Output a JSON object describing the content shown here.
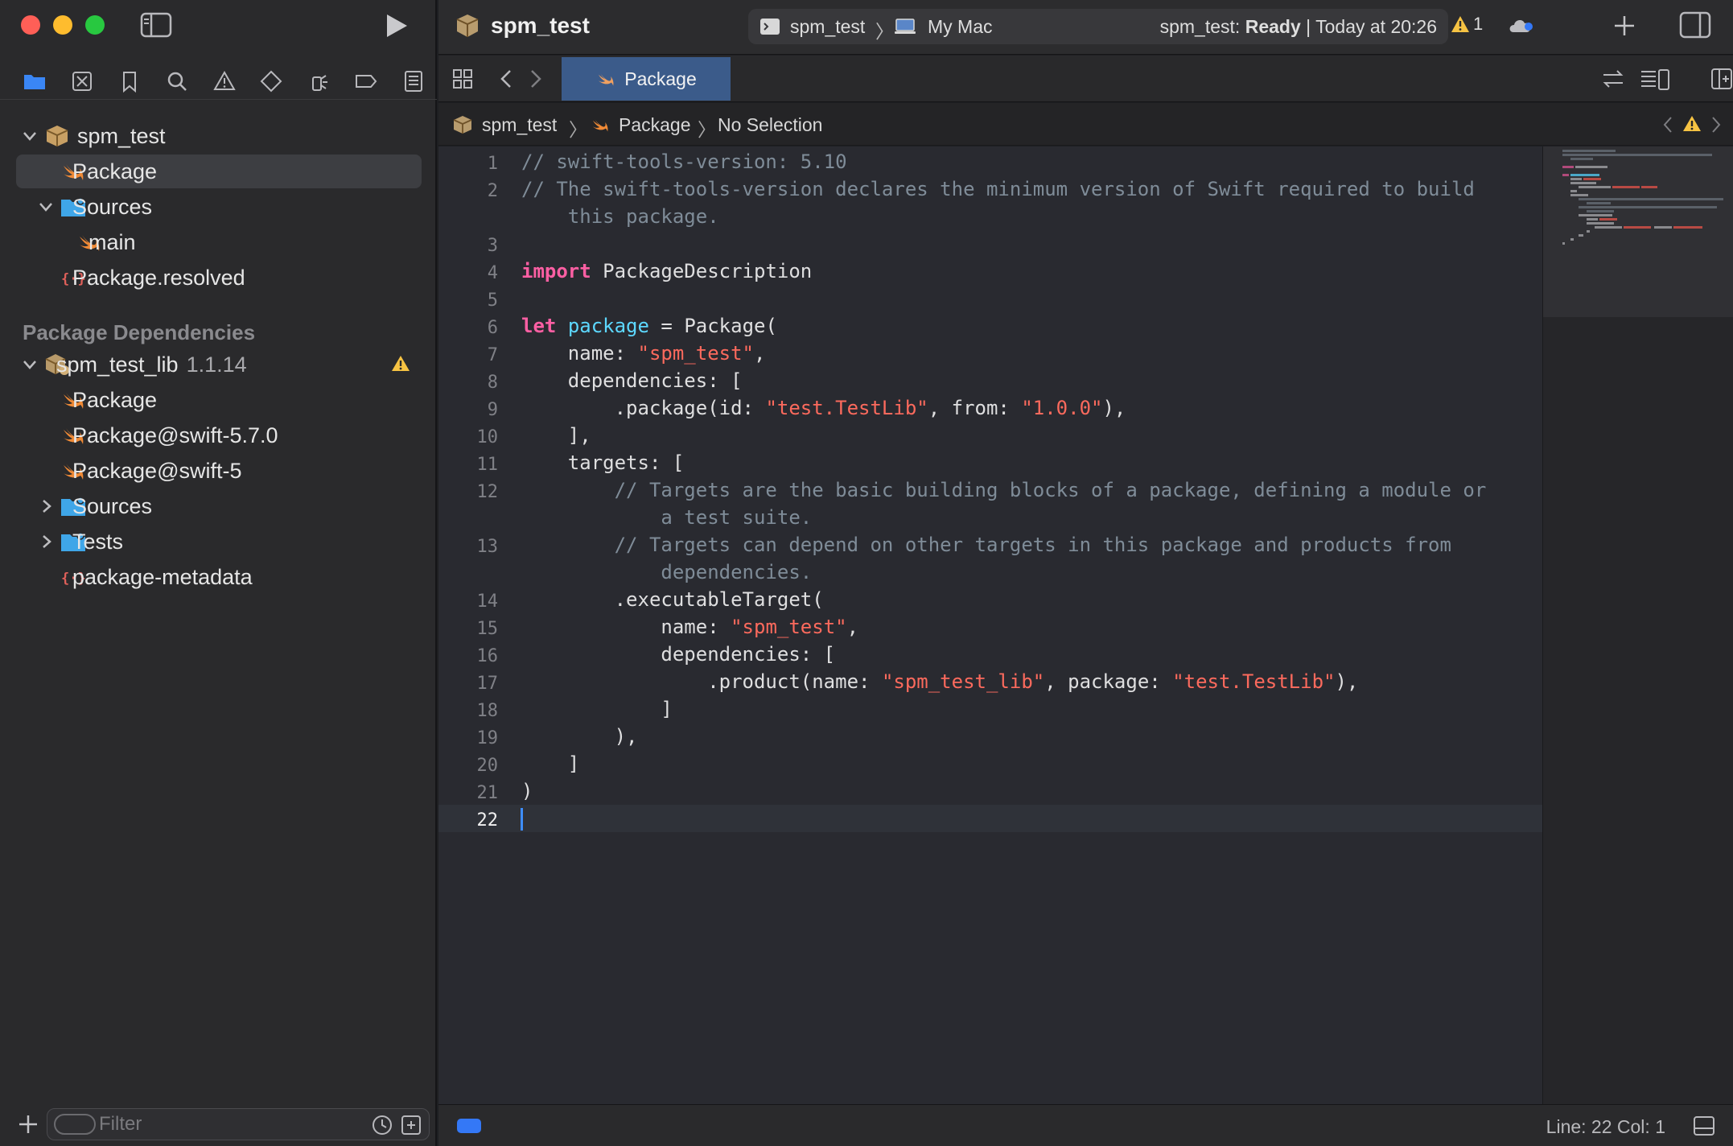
{
  "window": {
    "project_title": "spm_test",
    "scheme": "spm_test",
    "destination": "My Mac",
    "status_prefix": "spm_test:",
    "status_state": "Ready",
    "status_time": "| Today at 20:26",
    "warning_count": "1"
  },
  "tab": {
    "label": "Package"
  },
  "jumpbar": {
    "project": "spm_test",
    "file": "Package",
    "selection": "No Selection"
  },
  "navigator": {
    "project": {
      "name": "spm_test",
      "items": [
        {
          "label": "Package"
        },
        {
          "label": "Sources"
        },
        {
          "label": "main"
        },
        {
          "label": "Package.resolved"
        }
      ]
    },
    "dependencies_title": "Package Dependencies",
    "dependency": {
      "name": "spm_test_lib",
      "version": "1.1.14",
      "items": [
        {
          "label": "Package"
        },
        {
          "label": "Package@swift-5.7.0"
        },
        {
          "label": "Package@swift-5"
        },
        {
          "label": "Sources"
        },
        {
          "label": "Tests"
        },
        {
          "label": "package-metadata"
        }
      ]
    },
    "filter_placeholder": "Filter"
  },
  "editor": {
    "line_numbers": [
      "1",
      "2",
      "3",
      "4",
      "5",
      "6",
      "7",
      "8",
      "9",
      "10",
      "11",
      "12",
      "13",
      "14",
      "15",
      "16",
      "17",
      "18",
      "19",
      "20",
      "21",
      "22"
    ],
    "code": {
      "l1": "// swift-tools-version: 5.10",
      "l2a": "// The swift-tools-version declares the minimum version of Swift required to build",
      "l2b": "    this package.",
      "l4_kw": "import",
      "l4_rest": " PackageDescription",
      "l6_kw": "let",
      "l6_name": "package",
      "l6_rest": " = Package(",
      "l7_pre": "    name: ",
      "l7_str": "\"spm_test\"",
      "l7_post": ",",
      "l8": "    dependencies: [",
      "l9_pre": "        .package(id: ",
      "l9_str1": "\"test.TestLib\"",
      "l9_mid": ", from: ",
      "l9_str2": "\"1.0.0\"",
      "l9_post": "),",
      "l10": "    ],",
      "l11": "    targets: [",
      "l12a": "        // Targets are the basic building blocks of a package, defining a module or",
      "l12b": "            a test suite.",
      "l13a": "        // Targets can depend on other targets in this package and products from",
      "l13b": "            dependencies.",
      "l14": "        .executableTarget(",
      "l15_pre": "            name: ",
      "l15_str": "\"spm_test\"",
      "l15_post": ",",
      "l16": "            dependencies: [",
      "l17_pre": "                .product(name: ",
      "l17_str1": "\"spm_test_lib\"",
      "l17_mid": ", package: ",
      "l17_str2": "\"test.TestLib\"",
      "l17_post": "),",
      "l18": "            ]",
      "l19": "        ),",
      "l20": "    ]",
      "l21": ")"
    }
  },
  "statusbar": {
    "position": "Line: 22  Col: 1"
  },
  "colors": {
    "keyword": "#fc5fa3",
    "string": "#fc6a5d",
    "comment": "#7f8c98",
    "declaration": "#5dd8ff",
    "accent": "#3478f6",
    "swift_orange": "#f08a36"
  },
  "icons": [
    "swift-file-icon",
    "folder-icon",
    "package-icon",
    "json-icon",
    "warning-icon",
    "play-icon",
    "sidebar-toggle-icon",
    "cloud-icon",
    "plus-icon",
    "inspector-icon"
  ]
}
